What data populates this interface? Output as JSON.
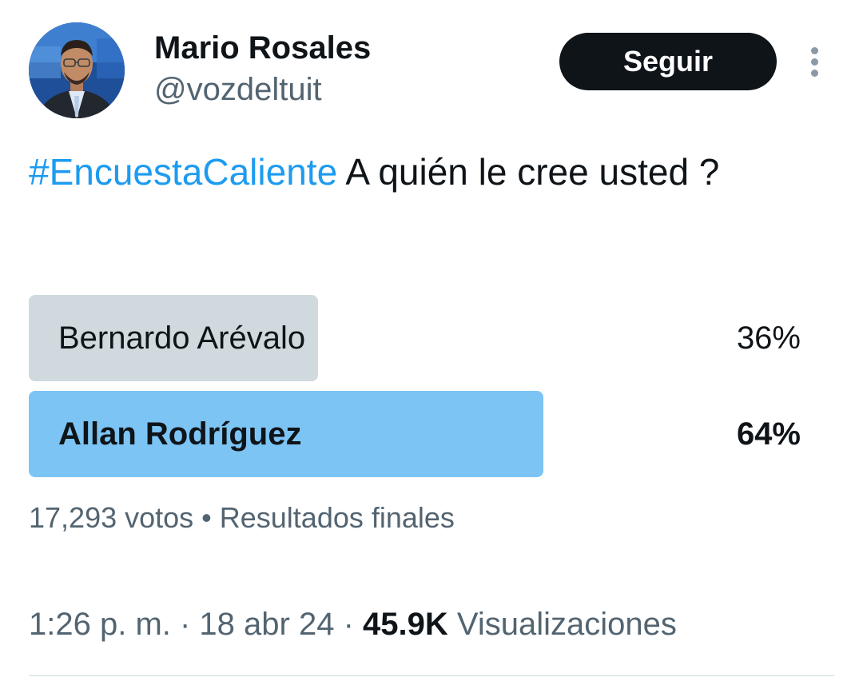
{
  "author": {
    "display_name": "Mario Rosales",
    "handle": "@vozdeltuit"
  },
  "follow_button_label": "Seguir",
  "tweet": {
    "hashtag": "#EncuestaCaliente",
    "text": " A quién le cree usted ?"
  },
  "poll": {
    "options": [
      {
        "label": "Bernardo Arévalo",
        "percent_text": "36%",
        "percent": 36
      },
      {
        "label": "Allan Rodríguez",
        "percent_text": "64%",
        "percent": 64
      }
    ],
    "votes": "17,293 votos",
    "separator": " • ",
    "status": "Resultados finales"
  },
  "meta": {
    "time": "1:26 p. m.",
    "sep1": " · ",
    "date": "18 abr 24",
    "sep2": " · ",
    "views_count": "45.9K",
    "views_label": " Visualizaciones"
  },
  "colors": {
    "hashtag": "#1d9bf0",
    "winning_bar": "#7cc4f4",
    "losing_bar": "#cfd9de",
    "follow_button": "#0f1419",
    "secondary_text": "#536471"
  },
  "icons": {
    "more": "vertical-ellipsis"
  }
}
